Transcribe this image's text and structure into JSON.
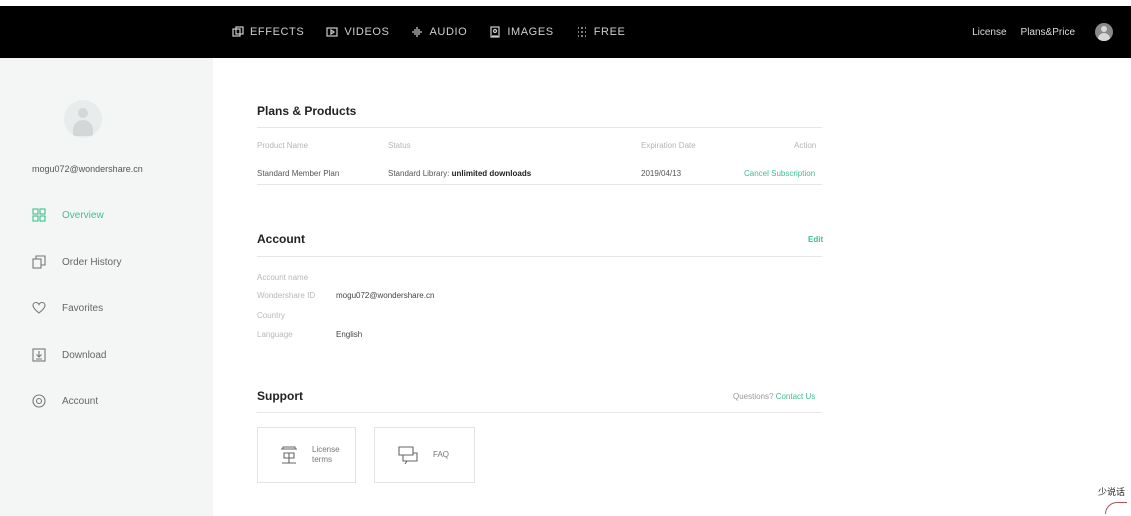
{
  "topnav": {
    "items": [
      {
        "label": "EFFECTS",
        "icon": "effects-icon"
      },
      {
        "label": "VIDEOS",
        "icon": "video-icon"
      },
      {
        "label": "AUDIO",
        "icon": "audio-icon"
      },
      {
        "label": "IMAGES",
        "icon": "image-icon"
      },
      {
        "label": "FREE",
        "icon": "free-icon"
      }
    ],
    "license": "License",
    "plans_price": "Plans&Price"
  },
  "sidebar": {
    "email": "mogu072@wondershare.cn",
    "items": [
      {
        "label": "Overview",
        "icon": "grid-icon",
        "active": true
      },
      {
        "label": "Order History",
        "icon": "copy-icon",
        "active": false
      },
      {
        "label": "Favorites",
        "icon": "heart-icon",
        "active": false
      },
      {
        "label": "Download",
        "icon": "download-icon",
        "active": false
      },
      {
        "label": "Account",
        "icon": "account-icon",
        "active": false
      }
    ]
  },
  "plans": {
    "title": "Plans & Products",
    "headers": {
      "product": "Product Name",
      "status": "Status",
      "expiration": "Expiration Date",
      "action": "Action"
    },
    "row": {
      "product": "Standard Member Plan",
      "status_prefix": "Standard Library:",
      "status_bold": "unlimited downloads",
      "expiration": "2019/04/13",
      "action": "Cancel Subscription"
    }
  },
  "account": {
    "title": "Account",
    "edit": "Edit",
    "fields": {
      "name_label": "Account name",
      "id_label": "Wondershare ID",
      "id_value": "mogu072@wondershare.cn",
      "country_label": "Country",
      "language_label": "Language",
      "language_value": "English"
    }
  },
  "support": {
    "title": "Support",
    "question": "Questions?",
    "contact": "Contact Us",
    "cards": [
      {
        "label_line1": "License",
        "label_line2": "terms",
        "icon": "license-icon"
      },
      {
        "label_line1": "FAQ",
        "icon": "faq-icon"
      }
    ]
  },
  "colors": {
    "accent": "#3fbf8e",
    "topbar": "#000000",
    "sidebar": "#f3f6f5"
  },
  "watermark": "少说话"
}
